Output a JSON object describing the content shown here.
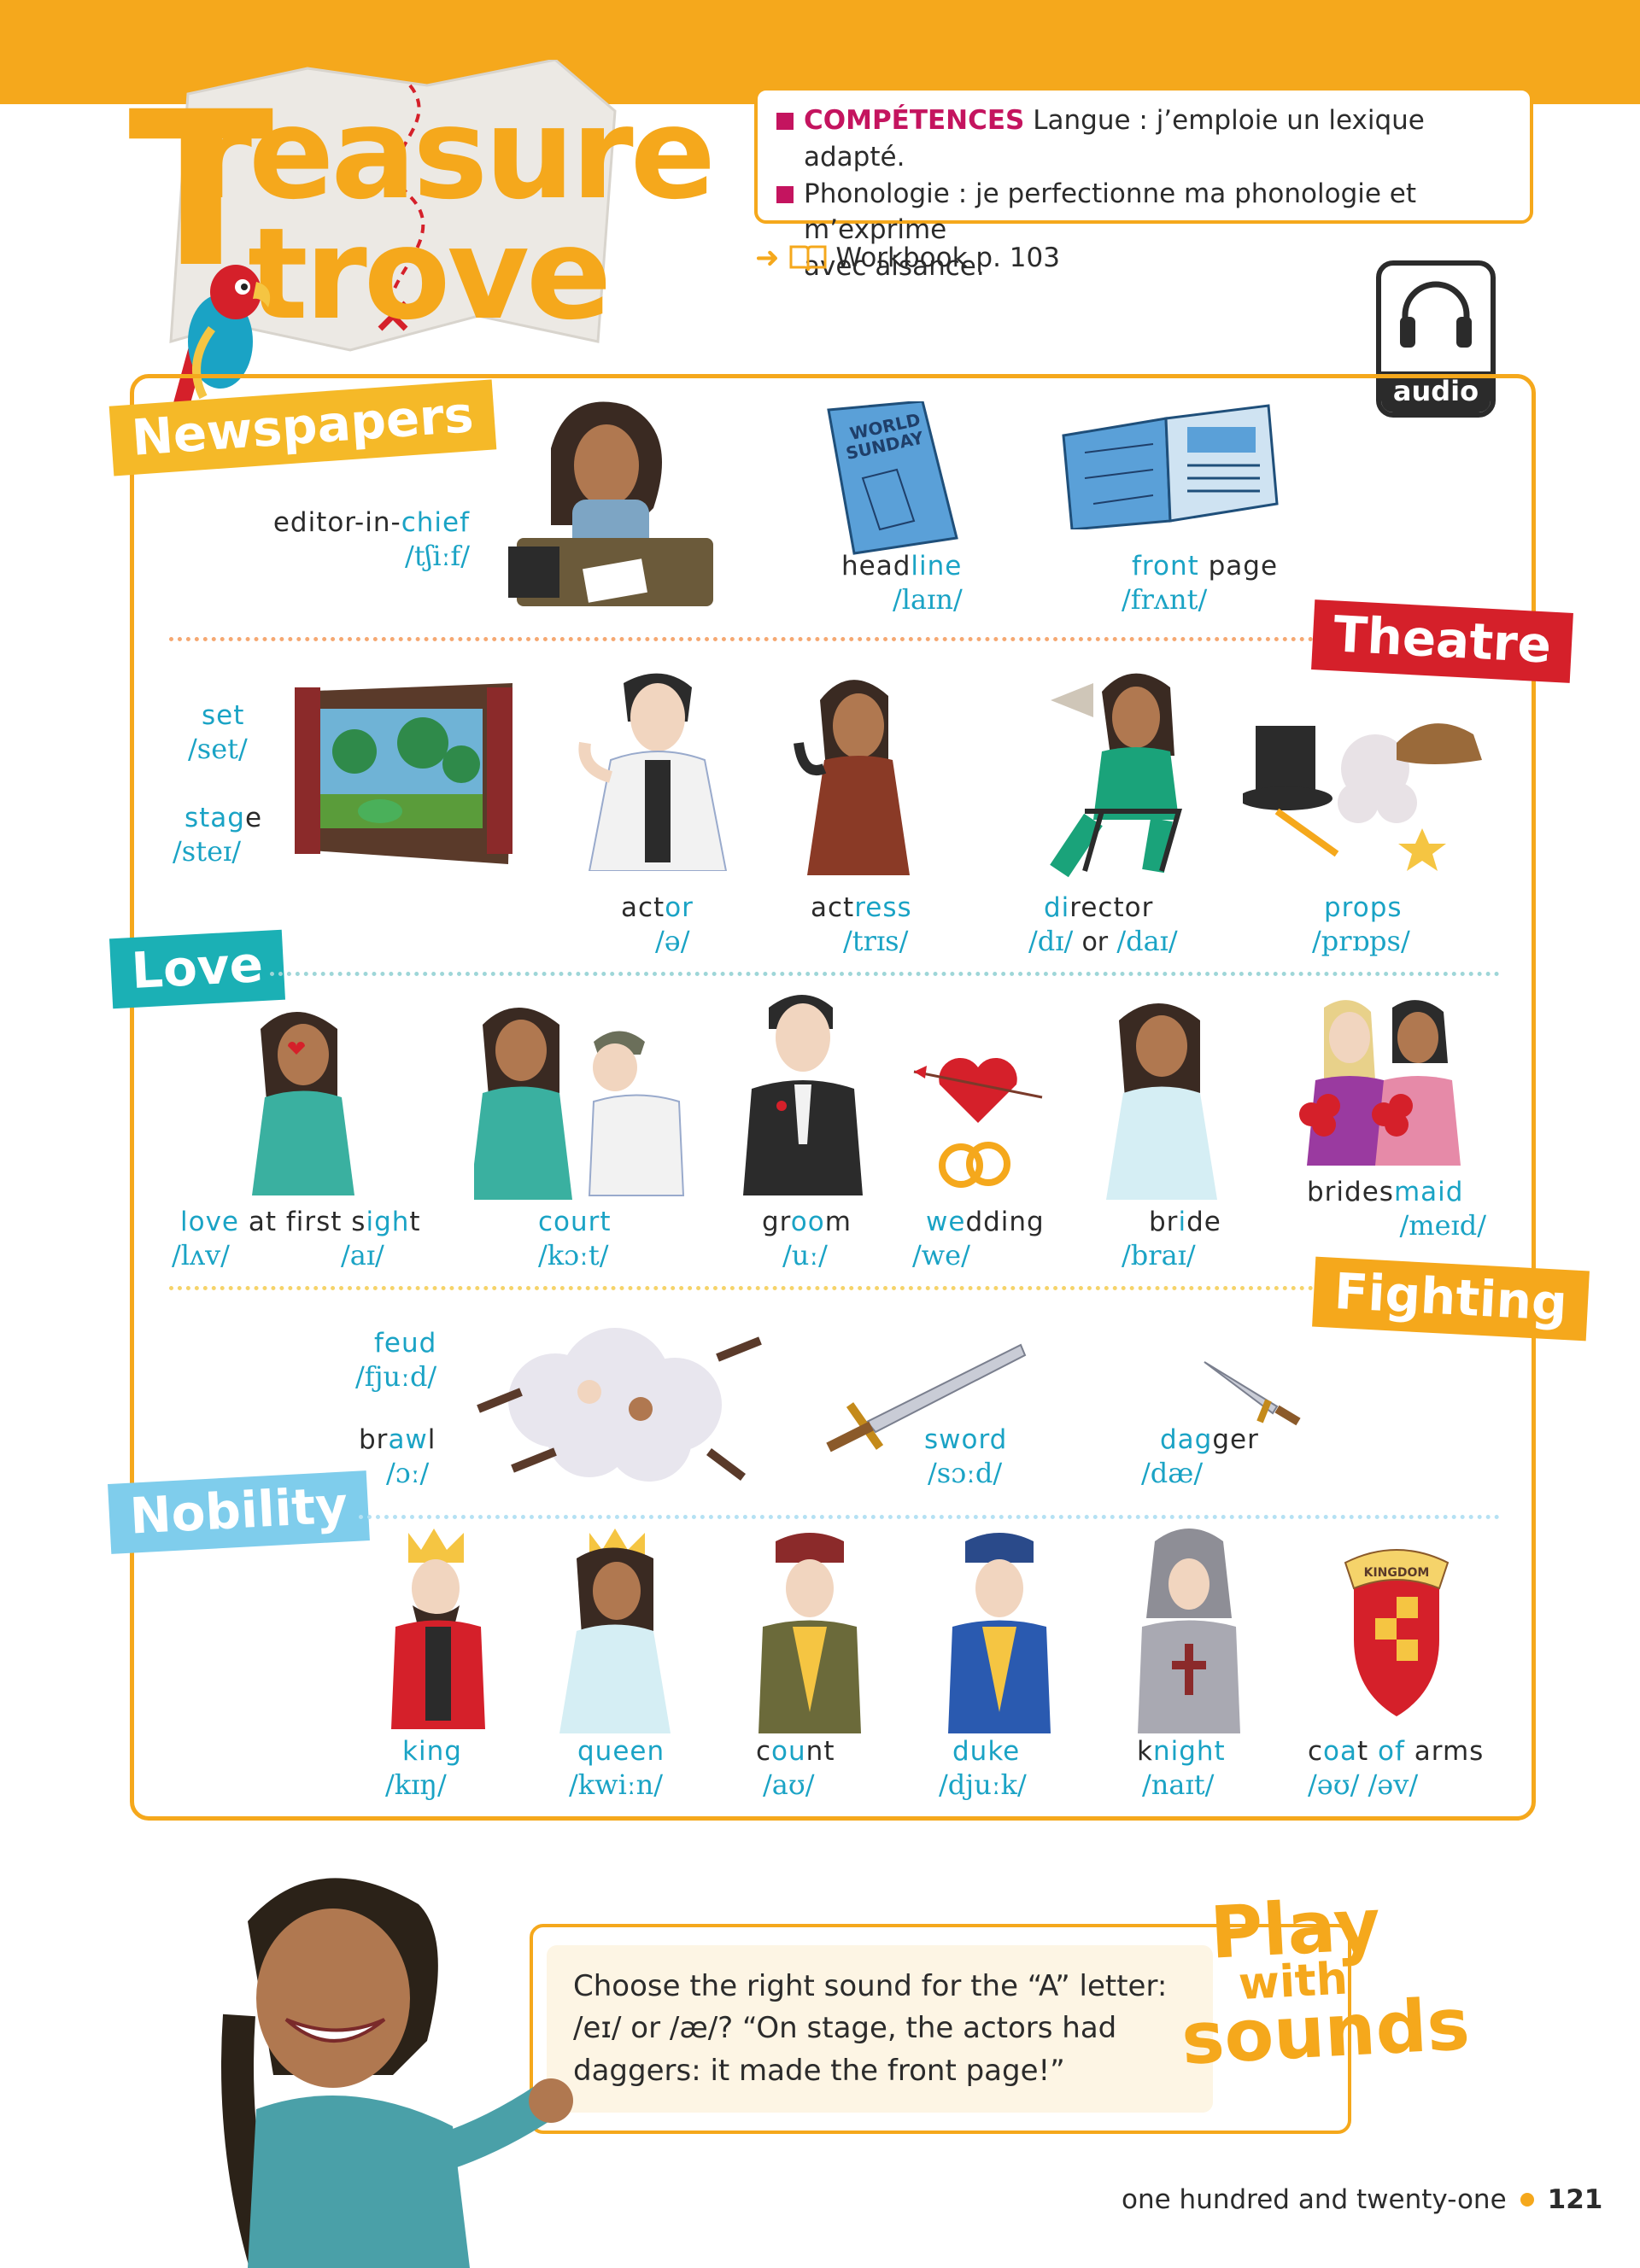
{
  "title": {
    "line1": "reasure",
    "line2": "trove",
    "big_t": "T"
  },
  "competences": {
    "label": "COMPÉTENCES",
    "item1": "Langue : j’emploie un lexique adapté.",
    "item2_a": "Phonologie : je perfectionne ma phonologie et m’exprime",
    "item2_b": "avec aisance."
  },
  "workbook": "Workbook p. 103",
  "audio_label": "audio",
  "sections": {
    "newspapers": "Newspapers",
    "theatre": "Theatre",
    "love": "Love",
    "fighting": "Fighting",
    "nobility": "Nobility"
  },
  "illustrations": {
    "newspaper_masthead_1": "WORLD",
    "newspaper_masthead_2": "SUNDAY",
    "shield_banner": "KINGDOM"
  },
  "vocab": {
    "editor": {
      "a": "editor-in-",
      "b": "chief",
      "ipa": "/tʃiːf/"
    },
    "headline": {
      "a": "head",
      "b": "line",
      "ipa": "/laɪn/"
    },
    "front_page": {
      "a": "front",
      "b": " page",
      "ipa": "/frʌnt/"
    },
    "set": {
      "a": "set",
      "ipa": "/set/"
    },
    "stage": {
      "a": "stag",
      "b": "e",
      "ipa": "/steɪ/"
    },
    "actor": {
      "a": "act",
      "b": "or",
      "ipa": "/ə/"
    },
    "actress": {
      "a": "act",
      "b": "ress",
      "ipa": "/trɪs/"
    },
    "director": {
      "a": "di",
      "b": "rector",
      "ipa_a": "/dɪ/",
      "ipa_or": "or",
      "ipa_b": "/daɪ/"
    },
    "props": {
      "a": "props",
      "ipa": "/prɒps/"
    },
    "love": {
      "a": "love",
      "b": " at first s",
      "c": "igh",
      "d": "t",
      "ipa_a": "/lʌv/",
      "ipa_b": "/aɪ/"
    },
    "court": {
      "a": "court",
      "ipa": "/kɔːt/"
    },
    "groom": {
      "a": "gr",
      "b": "oo",
      "c": "m",
      "ipa": "/uː/"
    },
    "wedding": {
      "a": "we",
      "b": "dding",
      "ipa": "/we/"
    },
    "bride": {
      "a": "br",
      "b": "i",
      "c": "de",
      "ipa": "/braɪ/"
    },
    "bridesmaid": {
      "a": "brides",
      "b": "maid",
      "ipa": "/meɪd/"
    },
    "feud": {
      "a": "feud",
      "ipa": "/fjuːd/"
    },
    "brawl": {
      "a": "br",
      "b": "aw",
      "c": "l",
      "ipa": "/ɔː/"
    },
    "sword": {
      "a": "sword",
      "ipa": "/sɔːd/"
    },
    "dagger": {
      "a": "dag",
      "b": "ger",
      "ipa": "/dæ/"
    },
    "king": {
      "a": "king",
      "ipa": "/kɪŋ/"
    },
    "queen": {
      "a": "queen",
      "ipa": "/kwiːn/"
    },
    "count": {
      "a": "c",
      "b": "ou",
      "c": "nt",
      "ipa": "/aʊ/"
    },
    "duke": {
      "a": "duke",
      "ipa": "/djuːk/"
    },
    "knight": {
      "a": "k",
      "b": "night",
      "ipa": "/naɪt/"
    },
    "coat": {
      "a": "c",
      "b": "oa",
      "c": "t ",
      "d": "of",
      "e": " arms",
      "ipa": "/əʊ/ /əv/"
    }
  },
  "play_with_sounds": {
    "text_1": "Choose the right sound for the “A” letter:",
    "text_2": "/eɪ/ or /æ/? “On stage, the actors had",
    "text_3": "daggers: it made the front page!”",
    "title_a": "Play",
    "title_b": "with",
    "title_c": "sounds"
  },
  "footer": {
    "words": "one hundred and twenty-one",
    "number": "121"
  }
}
